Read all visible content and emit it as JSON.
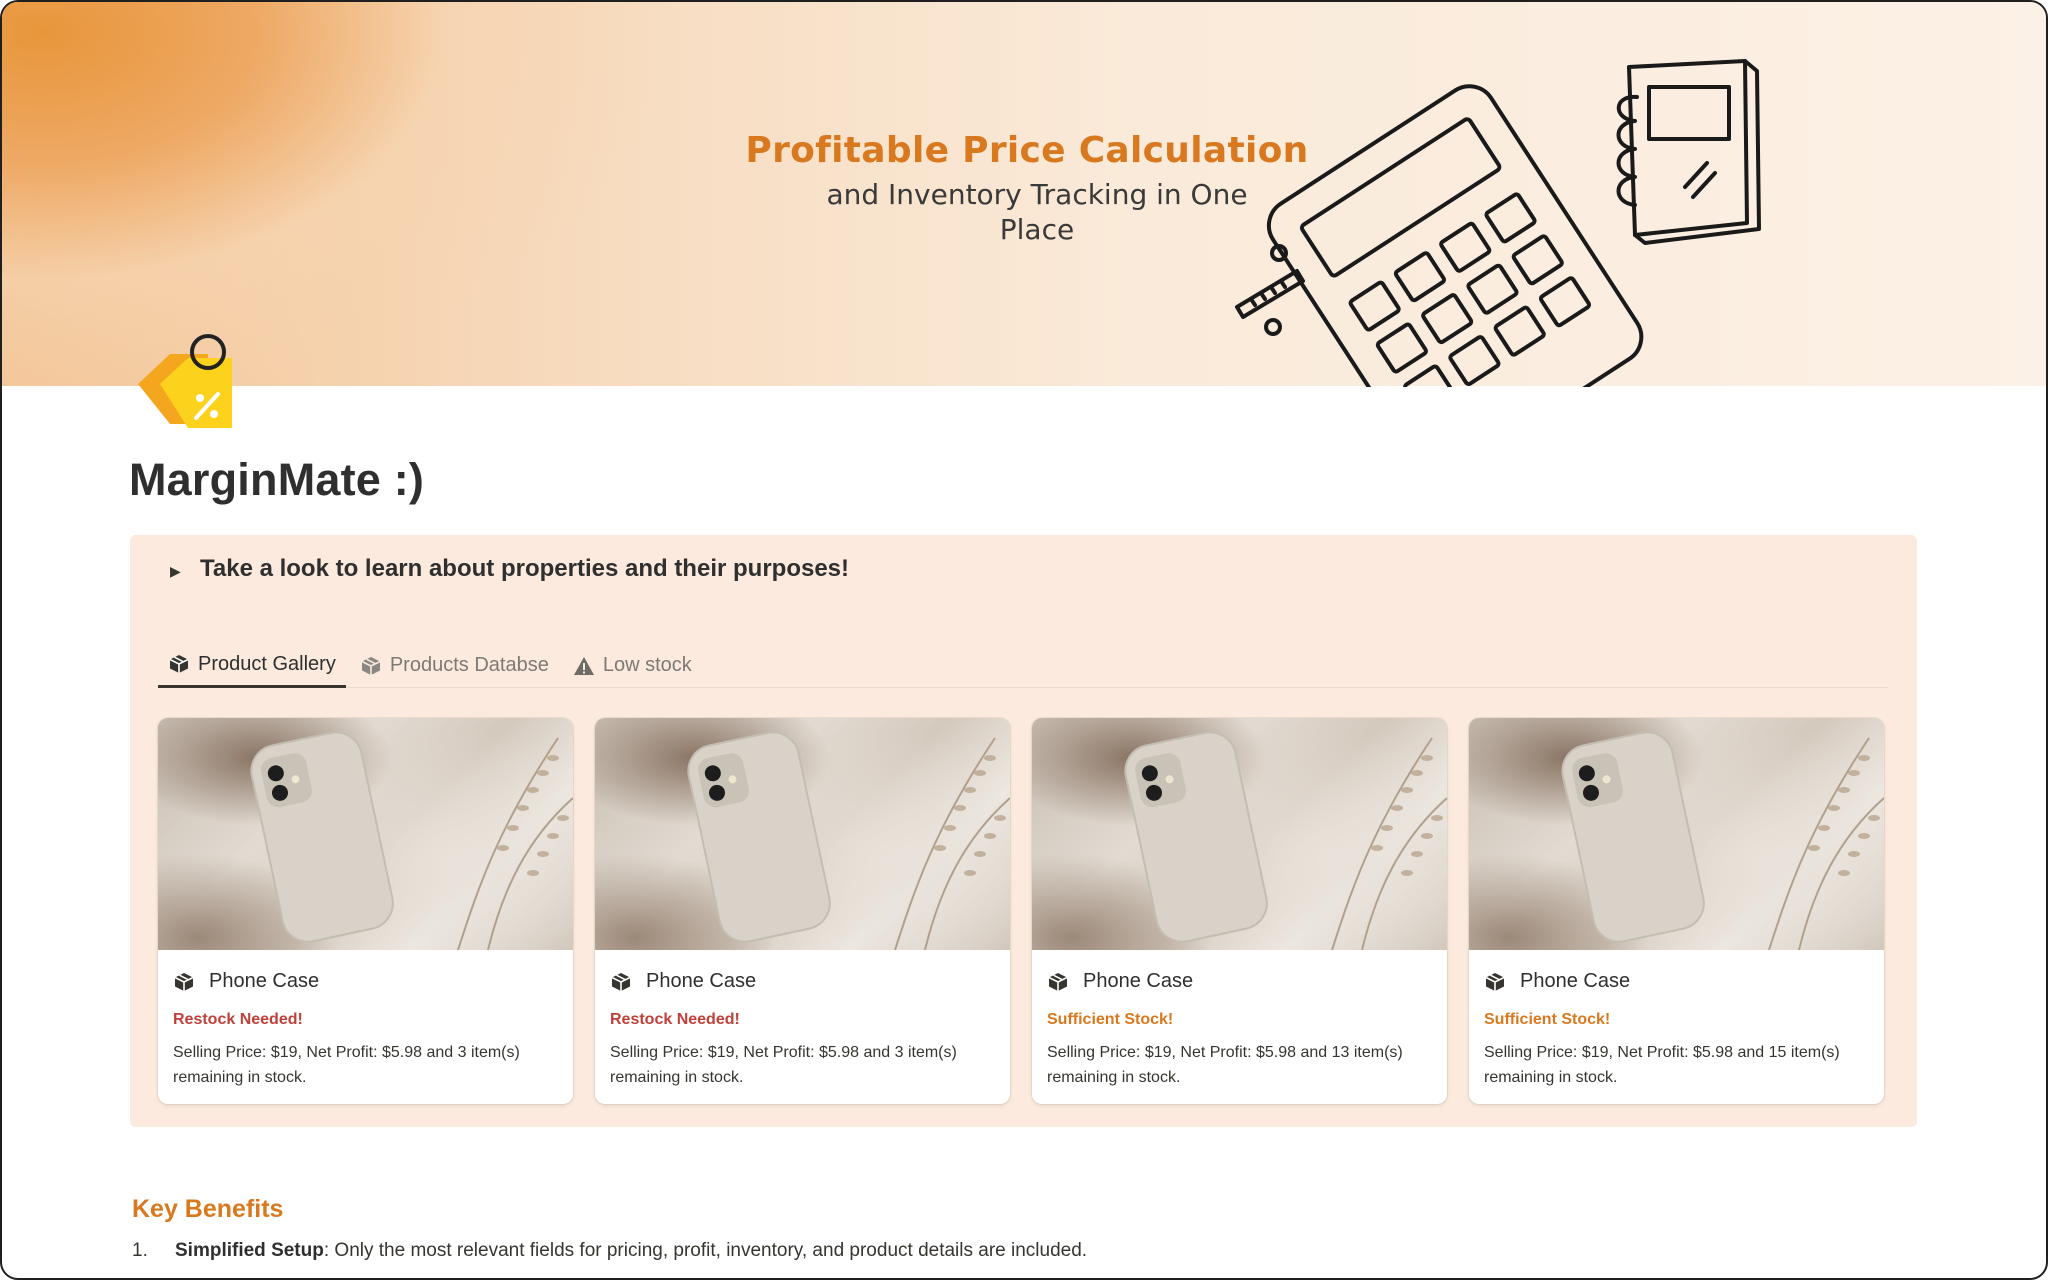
{
  "cover": {
    "title": "Profitable Price Calculation",
    "subtitle": "and Inventory Tracking in One Place"
  },
  "page": {
    "icon": "price-tag-percent-icon",
    "title": "MarginMate :)"
  },
  "callout": {
    "toggle_text": "Take a look to learn about properties and their purposes!"
  },
  "tabs": [
    {
      "label": "Product Gallery",
      "icon": "package-icon",
      "active": true
    },
    {
      "label": "Products Databse",
      "icon": "package-icon",
      "active": false
    },
    {
      "label": "Low stock",
      "icon": "warning-icon",
      "active": false
    }
  ],
  "cards": [
    {
      "name": "Phone Case",
      "status": "Restock Needed!",
      "description": "Selling Price: $19, Net Profit: $5.98 and 3 item(s) remaining in stock."
    },
    {
      "name": "Phone Case",
      "status": "Restock Needed!",
      "description": "Selling Price: $19, Net Profit: $5.98 and 3 item(s) remaining in stock."
    },
    {
      "name": "Phone Case",
      "status": "Sufficient Stock!",
      "description": "Selling Price: $19, Net Profit: $5.98 and 13 item(s) remaining in stock."
    },
    {
      "name": "Phone Case",
      "status": "Sufficient Stock!",
      "description": "Selling Price: $19, Net Profit: $5.98 and 15 item(s) remaining in stock."
    }
  ],
  "colors": {
    "accent": "#d9791f",
    "restock": "#c0403a",
    "sufficient": "#d9791f",
    "callout_bg": "#fbeadd"
  },
  "key_benefits": {
    "heading": "Key Benefits",
    "items": [
      {
        "number": "1.",
        "title": "Simplified Setup",
        "text": ": Only the most relevant fields for pricing, profit, inventory, and product details are included."
      }
    ]
  }
}
